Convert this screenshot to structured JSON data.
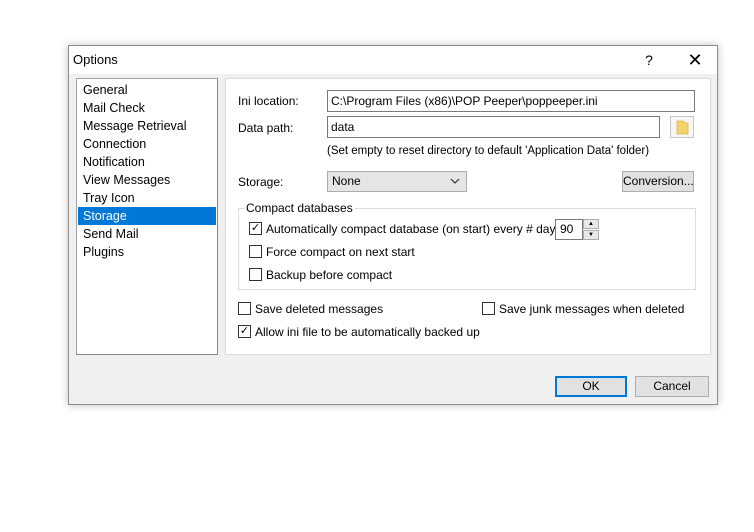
{
  "window": {
    "title": "Options",
    "help_glyph": "?",
    "close_glyph": "✕"
  },
  "nav": {
    "items": [
      {
        "label": "General"
      },
      {
        "label": "Mail Check"
      },
      {
        "label": "Message Retrieval"
      },
      {
        "label": "Connection"
      },
      {
        "label": "Notification"
      },
      {
        "label": "View Messages"
      },
      {
        "label": "Tray Icon"
      },
      {
        "label": "Storage",
        "selected": true
      },
      {
        "label": "Send Mail"
      },
      {
        "label": "Plugins"
      }
    ]
  },
  "storage": {
    "ini_label": "Ini location:",
    "ini_value": "C:\\Program Files (x86)\\POP Peeper\\poppeeper.ini",
    "data_label": "Data path:",
    "data_value": "data",
    "hint": "(Set empty to reset directory to default 'Application Data' folder)",
    "storage_label": "Storage:",
    "storage_value": "None",
    "conversion_label": "Conversion...",
    "compact_group_title": "Compact databases",
    "auto_compact_label": "Automatically compact database (on start) every # days:",
    "auto_compact_checked": true,
    "days_value": "90",
    "force_compact_label": "Force compact on next start",
    "force_compact_checked": false,
    "backup_label": "Backup before compact",
    "backup_checked": false,
    "save_deleted_label": "Save deleted messages",
    "save_deleted_checked": false,
    "save_junk_label": "Save junk messages when deleted",
    "save_junk_checked": false,
    "allow_ini_label": "Allow ini file to be automatically backed up",
    "allow_ini_checked": true
  },
  "footer": {
    "ok_label": "OK",
    "cancel_label": "Cancel"
  },
  "colors": {
    "selection": "#0078d7",
    "dialog_bg": "#f0f0f0",
    "folder_icon": "#f5d36b"
  }
}
